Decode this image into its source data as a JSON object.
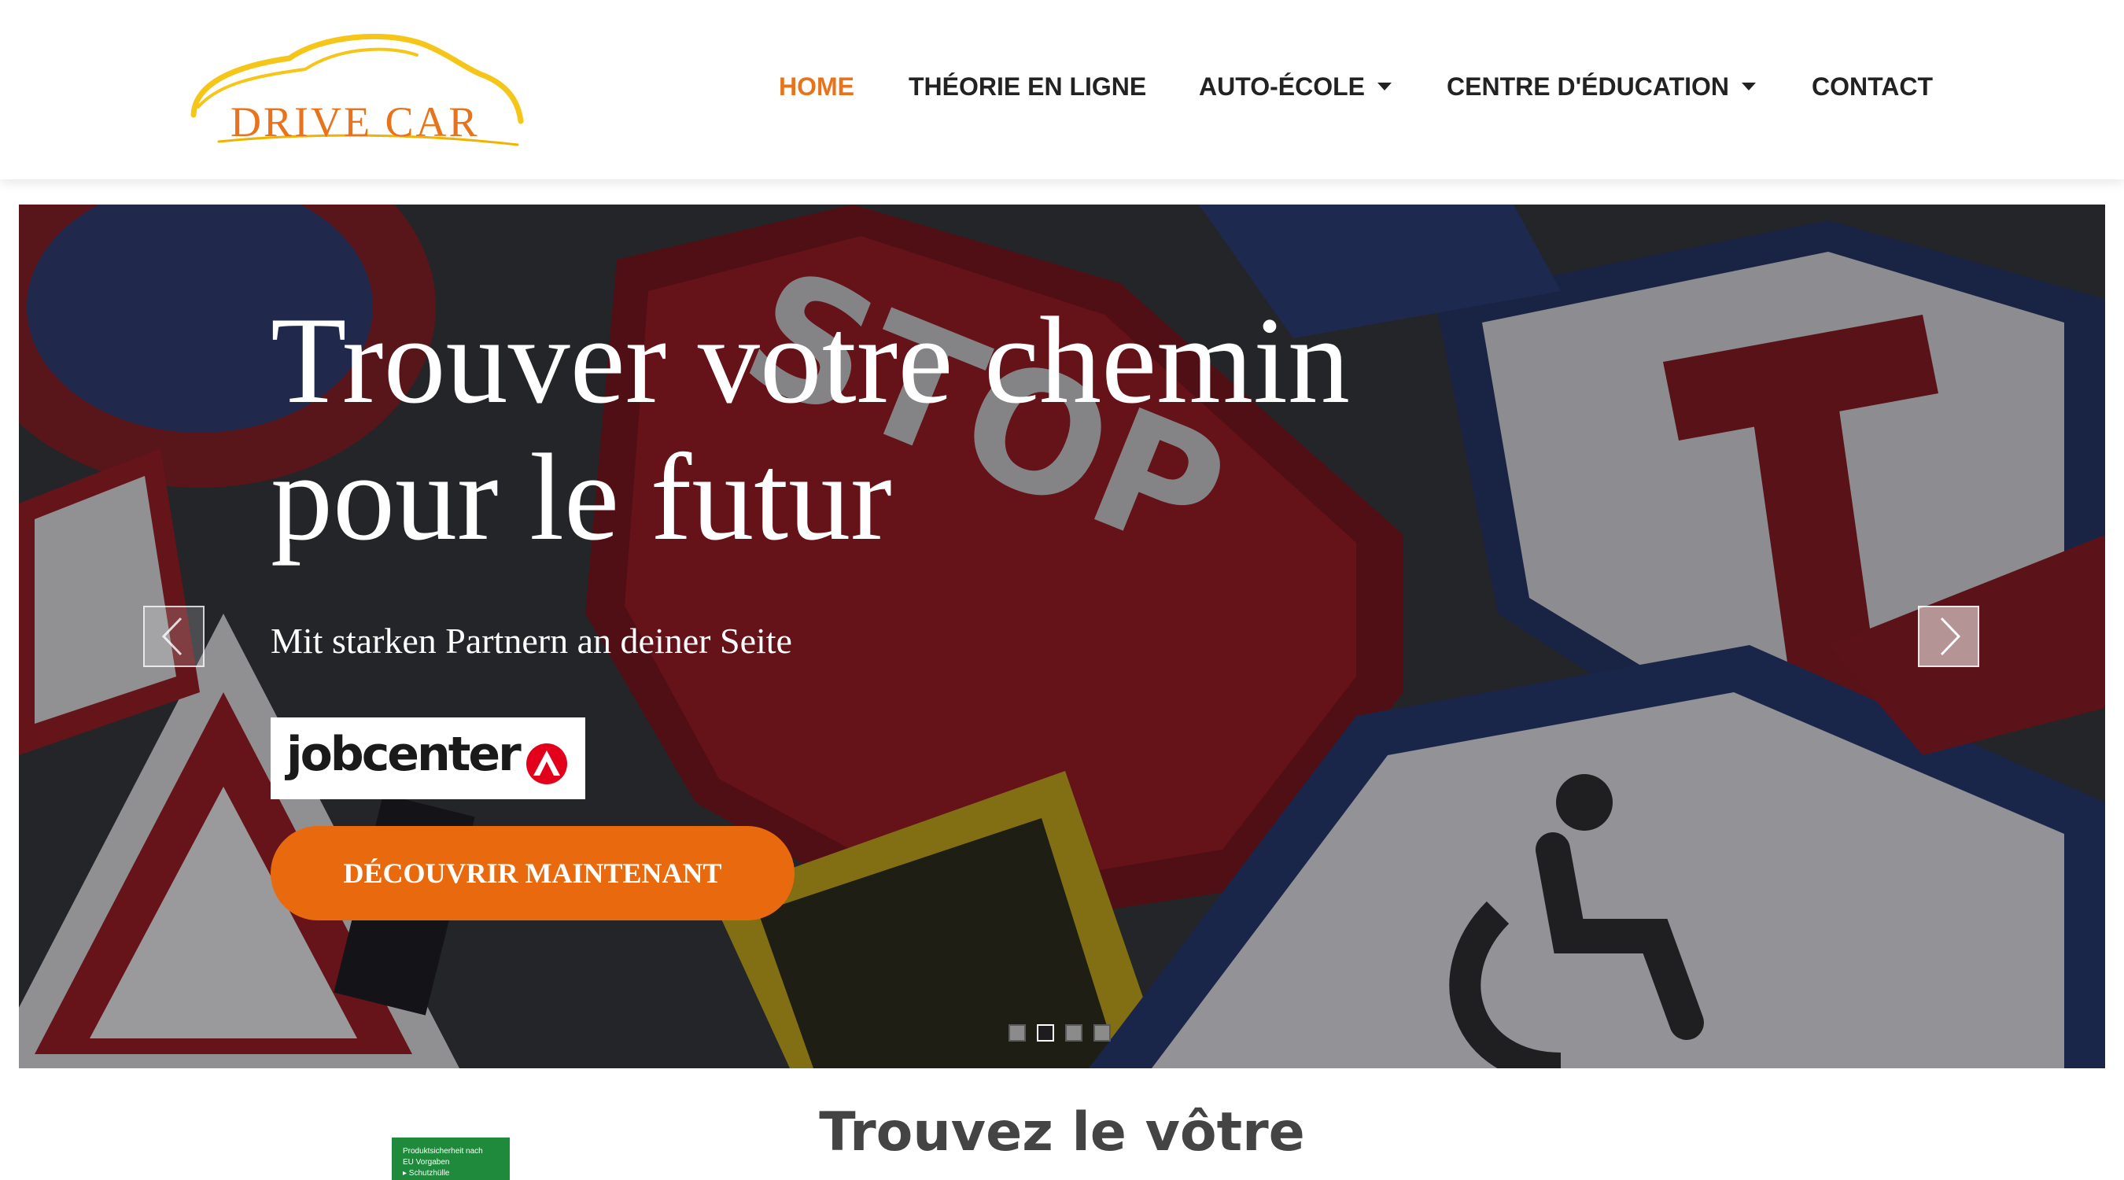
{
  "header": {
    "logo": {
      "text": "DRIVE CAR",
      "color": "#e8731a",
      "swoosh_color": "#f5c518"
    },
    "nav": [
      {
        "label": "HOME",
        "active": true,
        "dropdown": false
      },
      {
        "label": "THÉORIE EN LIGNE",
        "active": false,
        "dropdown": false
      },
      {
        "label": "AUTO-ÉCOLE",
        "active": false,
        "dropdown": true
      },
      {
        "label": "CENTRE D'ÉDUCATION",
        "active": false,
        "dropdown": true
      },
      {
        "label": "CONTACT",
        "active": false,
        "dropdown": false
      }
    ],
    "accent_color": "#e8731a"
  },
  "hero": {
    "title_line1": "Trouver votre chemin",
    "title_line2": "pour le futur",
    "subtitle": "Mit starken Partnern an deiner Seite",
    "partner_logo_text": "jobcenter",
    "cta_label": "DÉCOUVRIR MAINTENANT",
    "cta_color": "#e8690e",
    "slides_count": 4,
    "active_slide": 2,
    "prev_icon": "chevron-left-icon",
    "next_icon": "chevron-right-icon"
  },
  "section": {
    "title": "Trouvez le vôtre",
    "badge_lines": [
      "Produktsicherheit nach",
      "EU Vorgaben",
      "▸ Schutzhülle"
    ]
  }
}
